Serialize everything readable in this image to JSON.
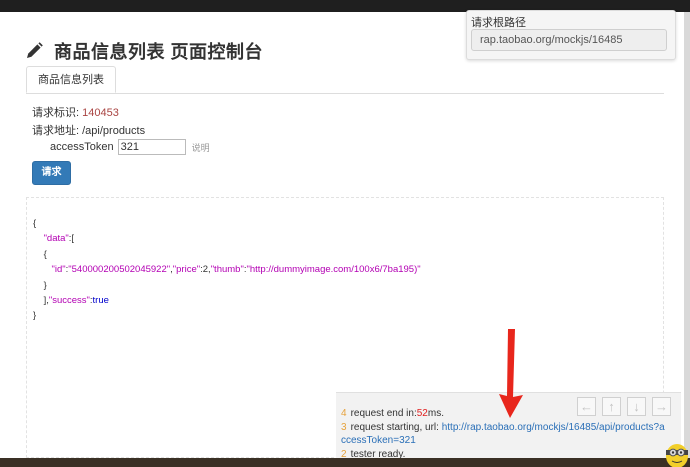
{
  "page": {
    "title": "商品信息列表 页面控制台"
  },
  "root_path": {
    "label": "请求根路径",
    "value": "rap.taobao.org/mockjs/16485"
  },
  "tabs": [
    {
      "label": "商品信息列表"
    }
  ],
  "request": {
    "id_label": "请求标识:",
    "id_value": "140453",
    "url_label": "请求地址:",
    "url_value": "/api/products",
    "param_name": "accessToken",
    "param_value": "321",
    "param_desc": "说明",
    "button_label": "请求"
  },
  "response": {
    "open_brace": "{",
    "data_key": "\"data\"",
    "open_bracket": ":[",
    "obj_open": "{",
    "id_key": "\"id\"",
    "id_value": "\"540000200502045922\"",
    "price_key": "\"price\"",
    "price_value": "2",
    "thumb_key": "\"thumb\"",
    "thumb_value": "\"http://dummyimage.com/100x6/7ba195)\"",
    "obj_close": "}",
    "close_bracket": "],",
    "success_key": "\"success\"",
    "success_value": "true",
    "close_brace": "}"
  },
  "console": {
    "logs": [
      {
        "num": "4",
        "pre": "request end in:",
        "highlight": "52",
        "post": "ms."
      },
      {
        "num": "3",
        "pre": "request starting, url: ",
        "link": "http://rap.taobao.org/mockjs/16485/api/products?a",
        "link2": "ccessToken=321"
      },
      {
        "num": "2",
        "pre": "tester ready."
      }
    ],
    "nav": [
      "←",
      "↑",
      "↓",
      "→"
    ]
  },
  "colors": {
    "primary": "#337ab7",
    "id_value": "#a94442",
    "json_key": "#b300b3",
    "json_bool": "#0000cc",
    "log_number": "#e6a23c",
    "log_highlight": "#e02020",
    "log_link": "#2a6fb7",
    "annotation_arrow": "#e8261c"
  },
  "icons": {
    "title": "pencil-icon",
    "annotation": "red-arrow-annotation"
  }
}
